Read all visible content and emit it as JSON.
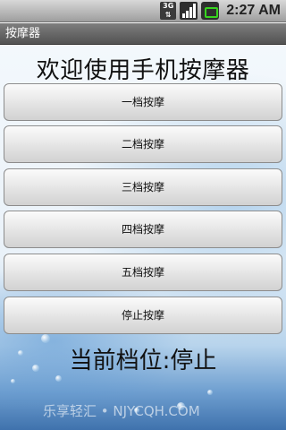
{
  "status_bar": {
    "network": "3G",
    "time": "2:27 AM"
  },
  "title_bar": {
    "title": "按摩器"
  },
  "main": {
    "heading": "欢迎使用手机按摩器",
    "buttons": [
      {
        "label": "一档按摩"
      },
      {
        "label": "二档按摩"
      },
      {
        "label": "三档按摩"
      },
      {
        "label": "四档按摩"
      },
      {
        "label": "五档按摩"
      },
      {
        "label": "停止按摩"
      }
    ],
    "current_level": "当前档位:停止",
    "watermark": "乐享轻汇 • NJYCQH.COM"
  },
  "colors": {
    "battery_accent": "#37d51e",
    "title_bar": "#5f5f5f"
  }
}
